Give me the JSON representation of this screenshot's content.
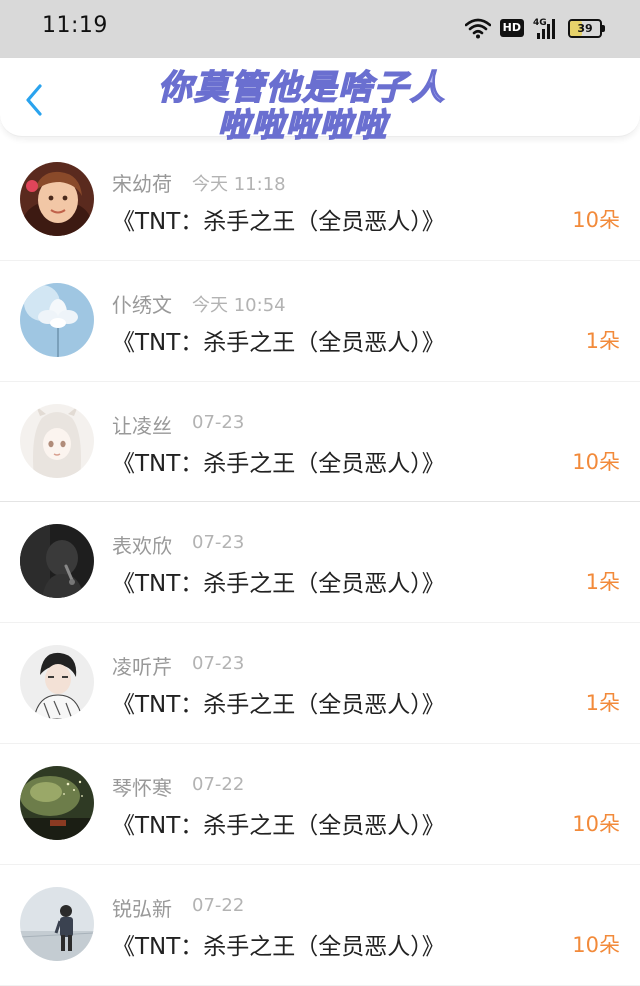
{
  "status_bar": {
    "time": "11:19",
    "network": "4G",
    "hd_badge": "HD",
    "battery_level": "39",
    "battery_fraction": 0.39
  },
  "header": {
    "back_icon": "chevron-left-icon",
    "overlay_line1": "你莫管他是啥子人",
    "overlay_line2": "啦啦啦啦啦"
  },
  "gifts": [
    {
      "name": "宋幼荷",
      "time": "今天 11:18",
      "title": "《TNT：杀手之王（全员恶人）》",
      "count": "10朵"
    },
    {
      "name": "仆绣文",
      "time": "今天 10:54",
      "title": "《TNT：杀手之王（全员恶人）》",
      "count": "1朵"
    },
    {
      "name": "让凌丝",
      "time": "07-23",
      "title": "《TNT：杀手之王（全员恶人）》",
      "count": "10朵"
    },
    {
      "name": "表欢欣",
      "time": "07-23",
      "title": "《TNT：杀手之王（全员恶人）》",
      "count": "1朵"
    },
    {
      "name": "凌听芹",
      "time": "07-23",
      "title": "《TNT：杀手之王（全员恶人）》",
      "count": "1朵"
    },
    {
      "name": "琴怀寒",
      "time": "07-22",
      "title": "《TNT：杀手之王（全员恶人）》",
      "count": "10朵"
    },
    {
      "name": "锐弘新",
      "time": "07-22",
      "title": "《TNT：杀手之王（全员恶人）》",
      "count": "10朵"
    }
  ],
  "colors": {
    "accent_blue": "#2aa3ee",
    "count_orange": "#f28a3a",
    "status_bar_bg": "#d9d9d9"
  }
}
